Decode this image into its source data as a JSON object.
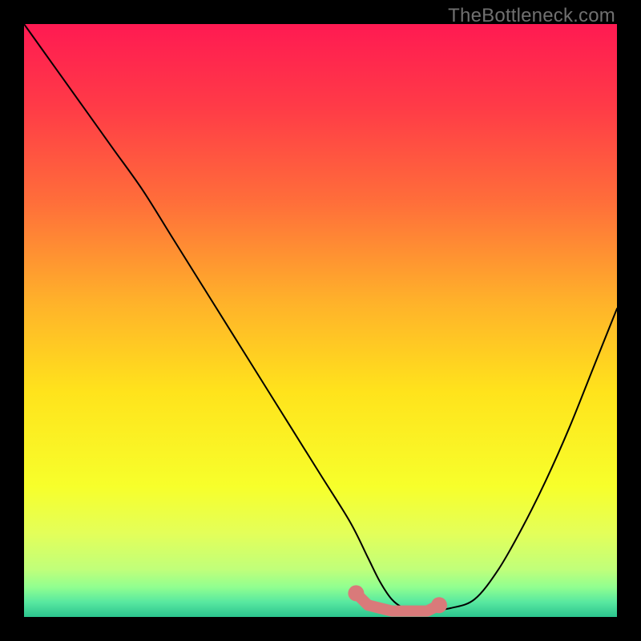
{
  "watermark": "TheBottleneck.com",
  "colors": {
    "gradient_stops": [
      {
        "offset": 0.0,
        "color": "#ff1a52"
      },
      {
        "offset": 0.14,
        "color": "#ff3b47"
      },
      {
        "offset": 0.3,
        "color": "#ff6e3a"
      },
      {
        "offset": 0.47,
        "color": "#ffb22a"
      },
      {
        "offset": 0.62,
        "color": "#ffe31c"
      },
      {
        "offset": 0.78,
        "color": "#f7ff2b"
      },
      {
        "offset": 0.86,
        "color": "#e3ff5a"
      },
      {
        "offset": 0.92,
        "color": "#c0ff7a"
      },
      {
        "offset": 0.95,
        "color": "#90ff90"
      },
      {
        "offset": 0.975,
        "color": "#58e8a0"
      },
      {
        "offset": 1.0,
        "color": "#2bc48e"
      }
    ],
    "curve_stroke": "#000000",
    "marker_fill": "#d97a7a",
    "marker_stroke": "#c96a6a",
    "background": "#000000"
  },
  "chart_data": {
    "type": "line",
    "title": "",
    "xlabel": "",
    "ylabel": "",
    "xlim": [
      0,
      100
    ],
    "ylim": [
      0,
      100
    ],
    "series": [
      {
        "name": "bottleneck-curve",
        "x": [
          0,
          5,
          10,
          15,
          20,
          25,
          30,
          35,
          40,
          45,
          50,
          55,
          58,
          60,
          62,
          64,
          66,
          68,
          72,
          76,
          80,
          84,
          88,
          92,
          96,
          100
        ],
        "y": [
          100,
          93,
          86,
          79,
          72,
          64,
          56,
          48,
          40,
          32,
          24,
          16,
          10,
          6,
          3,
          1.5,
          1,
          1,
          1.5,
          3,
          8,
          15,
          23,
          32,
          42,
          52
        ]
      }
    ],
    "markers": {
      "name": "optimal-zone",
      "x": [
        56,
        58,
        60,
        62,
        64,
        66,
        68,
        70
      ],
      "y": [
        4,
        2,
        1.5,
        1,
        1,
        1,
        1,
        2
      ]
    }
  }
}
